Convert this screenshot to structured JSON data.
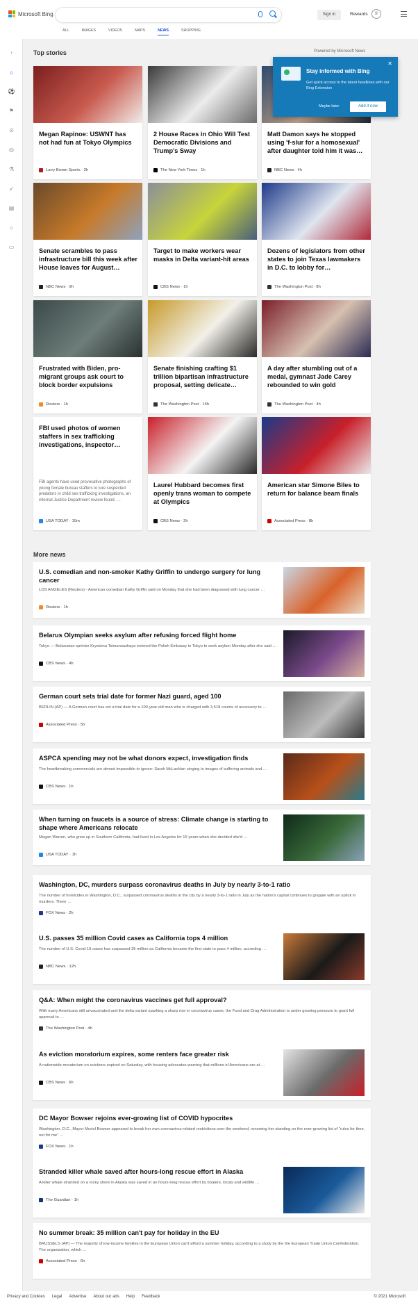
{
  "header": {
    "logo_text": "Microsoft Bing",
    "search_value": "",
    "sign_in": "Sign in",
    "rewards": "Rewards",
    "tabs": [
      {
        "label": "ALL",
        "active": false
      },
      {
        "label": "IMAGES",
        "active": false
      },
      {
        "label": "VIDEOS",
        "active": false
      },
      {
        "label": "MAPS",
        "active": false
      },
      {
        "label": "NEWS",
        "active": true
      },
      {
        "label": "SHOPPING",
        "active": false
      }
    ]
  },
  "colors": {
    "accent": "#174ae4",
    "popup": "#167ab8"
  },
  "rail_icons": [
    "chevron-right-icon",
    "home-icon",
    "sports-icon",
    "flag-icon",
    "location-pin-icon",
    "globe-icon",
    "flask-icon",
    "rocket-icon",
    "film-icon",
    "bank-icon",
    "credit-card-icon"
  ],
  "top_stories": {
    "title": "Top stories",
    "powered_by": "Powered by Microsoft News",
    "cards": [
      {
        "title": "Megan Rapinoe: USWNT has not had fun at Tokyo Olympics",
        "source": "Larry Brown Sports · 2h",
        "src_color": "#b11a1a",
        "img": [
          "#7b1f1f",
          "#c95b4f",
          "#f0ece8"
        ]
      },
      {
        "title": "2 House Races in Ohio Will Test Democratic Divisions and Trump's Sway",
        "source": "The New York Times · 1h",
        "src_color": "#000000",
        "img": [
          "#3a3a3a",
          "#ececec",
          "#6c6c6c"
        ]
      },
      {
        "title": "Matt Damon says he stopped using 'f-slur for a homosexual' after daughter told him it was…",
        "source": "NBC News · 4h",
        "src_color": "#222222",
        "img": [
          "#2c4a6e",
          "#b99a84",
          "#1c2733"
        ]
      },
      {
        "title": "Senate scrambles to pass infrastructure bill this week after House leaves for August…",
        "source": "NBC News · 9h",
        "src_color": "#222222",
        "img": [
          "#6a4a2a",
          "#c77a2a",
          "#8da3bd"
        ]
      },
      {
        "title": "Target to make workers wear masks in Delta variant-hit areas",
        "source": "CBS News · 1h",
        "src_color": "#111111",
        "img": [
          "#8a8f9a",
          "#c8d43a",
          "#4a5f7a"
        ]
      },
      {
        "title": "Dozens of legislators from other states to join Texas lawmakers in D.C. to lobby for…",
        "source": "The Washington Post · 8h",
        "src_color": "#333333",
        "img": [
          "#1e3a8a",
          "#dfe5ef",
          "#b02a3a"
        ]
      },
      {
        "title": "Frustrated with Biden, pro-migrant groups ask court to block border expulsions",
        "source": "Reuters · 1h",
        "src_color": "#f28b30",
        "img": [
          "#3b4a48",
          "#6d7d7a",
          "#2a3230"
        ]
      },
      {
        "title": "Senate finishing crafting $1 trillion bipartisan infrastructure proposal, setting delicate…",
        "source": "The Washington Post · 16h",
        "src_color": "#333333",
        "img": [
          "#c79a2a",
          "#f2f0e8",
          "#2a2a2a"
        ]
      },
      {
        "title": "A day after stumbling out of a medal, gymnast Jade Carey rebounded to win gold",
        "source": "The Washington Post · 4h",
        "src_color": "#333333",
        "img": [
          "#7a1f2a",
          "#d7c0b0",
          "#2b2b52"
        ]
      },
      {
        "title": "FBI used photos of women staffers in sex trafficking investigations, inspector…",
        "snippet": "FBI agents have used provocative photographs of young female bureau staffers to lure suspected predators in child sex trafficking investigations, an internal Justice Department review found. …",
        "source": "USA TODAY · 10m",
        "src_color": "#1e88e5",
        "img": []
      },
      {
        "title": "Laurel Hubbard becomes first openly trans woman to compete at Olympics",
        "source": "CBS News · 2h",
        "src_color": "#111111",
        "img": [
          "#c8202a",
          "#f4f4f4",
          "#2a2a2a"
        ]
      },
      {
        "title": "American star Simone Biles to return for balance beam finals",
        "source": "Associated Press · 8h",
        "src_color": "#d00000",
        "img": [
          "#1a3a8a",
          "#c8202a",
          "#e8e8e8"
        ]
      }
    ]
  },
  "popup": {
    "title": "Stay informed with Bing",
    "desc": "Get quick access to the latest headlines with our Bing Extension",
    "later": "Maybe later",
    "add": "Add it now"
  },
  "more_news": {
    "title": "More news",
    "items": [
      {
        "title": "U.S. comedian and non-smoker Kathy Griffin to undergo surgery for lung cancer",
        "snippet": "LOS ANGELES (Reuters) - American comedian Kathy Griffin said on Monday that she had been diagnosed with lung cancer …",
        "source": "Reuters · 1h",
        "src_color": "#f28b30",
        "img": [
          "#c9d6e4",
          "#d9622a",
          "#e8d6c0"
        ],
        "title2": ""
      },
      {
        "title": "Belarus Olympian seeks asylum after refusing forced flight home",
        "snippet": "Tokyo — Belarusian sprinter Krystsina Tsimanouskaya entered the Polish Embassy in Tokyo to seek asylum Monday after she said …",
        "source": "CBS News · 4h",
        "src_color": "#111111",
        "img": [
          "#1a1a2a",
          "#7a4a8a",
          "#d8b0a0"
        ]
      },
      {
        "title": "German court sets trial date for former Nazi guard, aged 100",
        "snippet": "BERLIN (AP) — A German court has set a trial date for a 100-year-old man who is charged with 3,518 counts of accessory to …",
        "source": "Associated Press · 5h",
        "src_color": "#d00000",
        "img": [
          "#6a6a6a",
          "#bcbcbc",
          "#3a3a3a"
        ]
      },
      {
        "title": "ASPCA spending may not be what donors expect, investigation finds",
        "snippet": "The heartbreaking commercials are almost impossible to ignore: Sarah McLachlan singing to images of suffering animals and …",
        "source": "CBS News · 1h",
        "src_color": "#111111",
        "img": [
          "#5a2a1a",
          "#b8501a",
          "#2a7a8a"
        ]
      },
      {
        "title": "When turning on faucets is a source of stress: Climate change is starting to shape where Americans relocate",
        "snippet": "Megan Warren, who grew up in Southern California, had lived in Los Angeles for 15 years when she decided she'd …",
        "source": "USA TODAY · 1h",
        "src_color": "#1e88e5",
        "img": [
          "#0f2a1a",
          "#3a6a3a",
          "#8aa0b8"
        ]
      },
      {
        "title": "Washington, DC, murders surpass coronavirus deaths in July by nearly 3-to-1 ratio",
        "snippet": "The number of homicides in Washington, D.C., surpassed coronavirus deaths in the city by a nearly 3-to-1 ratio in July as the nation's capital continues to grapple with an uptick in murders. There …",
        "source": "FOX News · 2h",
        "src_color": "#1a3a8a",
        "img": []
      },
      {
        "title": "U.S. passes 35 million Covid cases as California tops 4 million",
        "snippet": "The number of U.S. Covid-19 cases has surpassed 35 million as California became the first state to pass 4 million, according …",
        "source": "NBC News · 12h",
        "src_color": "#222222",
        "img": [
          "#c97a3a",
          "#1a1a1a",
          "#8a3a2a"
        ]
      },
      {
        "title": "Q&A: When might the coronavirus vaccines get full approval?",
        "snippet": "With many Americans still unvaccinated and the delta variant sparking a sharp rise in coronavirus cases, the Food and Drug Administration is under growing pressure to grant full approval to …",
        "source": "The Washington Post · 4h",
        "src_color": "#333333",
        "img": []
      },
      {
        "title": "As eviction moratorium expires, some renters face greater risk",
        "snippet": "A nationwide moratorium on evictions expired on Saturday, with housing advocates warning that millions of Americans are at …",
        "source": "CBS News · 6h",
        "src_color": "#111111",
        "img": [
          "#e4e4e4",
          "#6a6a6a",
          "#c8202a"
        ]
      },
      {
        "title": "DC Mayor Bowser rejoins ever-growing list of COVID hypocrites",
        "snippet": "Washington, D.C., Mayor Muriel Bowser appeared to break her own coronavirus-related restrictions over the weekend, renewing her standing on the ever-growing list of \"rules for thee, not for me\" …",
        "source": "FOX News · 1h",
        "src_color": "#1a3a8a",
        "img": []
      },
      {
        "title": "Stranded killer whale saved after hours-long rescue effort in Alaska",
        "snippet": "A killer whale stranded on a rocky shore in Alaska was saved in an hours-long rescue effort by boaters, locals and wildlife …",
        "source": "The Guardian · 1h",
        "src_color": "#0a3a7a",
        "img": [
          "#0a2a5a",
          "#1a5a9a",
          "#e8e8e8"
        ]
      },
      {
        "title": "No summer break: 35 million can't pay for holiday in the EU",
        "snippet": "BRUSSELS (AP) — The majority of low-income families in the European Union can't afford a summer holiday, according to a study by the the European Trade Union Confederation. The organization, which …",
        "source": "Associated Press · 6h",
        "src_color": "#d00000",
        "img": []
      }
    ]
  },
  "footer": {
    "links": [
      "Privacy and Cookies",
      "Legal",
      "Advertise",
      "About our ads",
      "Help",
      "Feedback"
    ],
    "copyright": "© 2021 Microsoft"
  }
}
